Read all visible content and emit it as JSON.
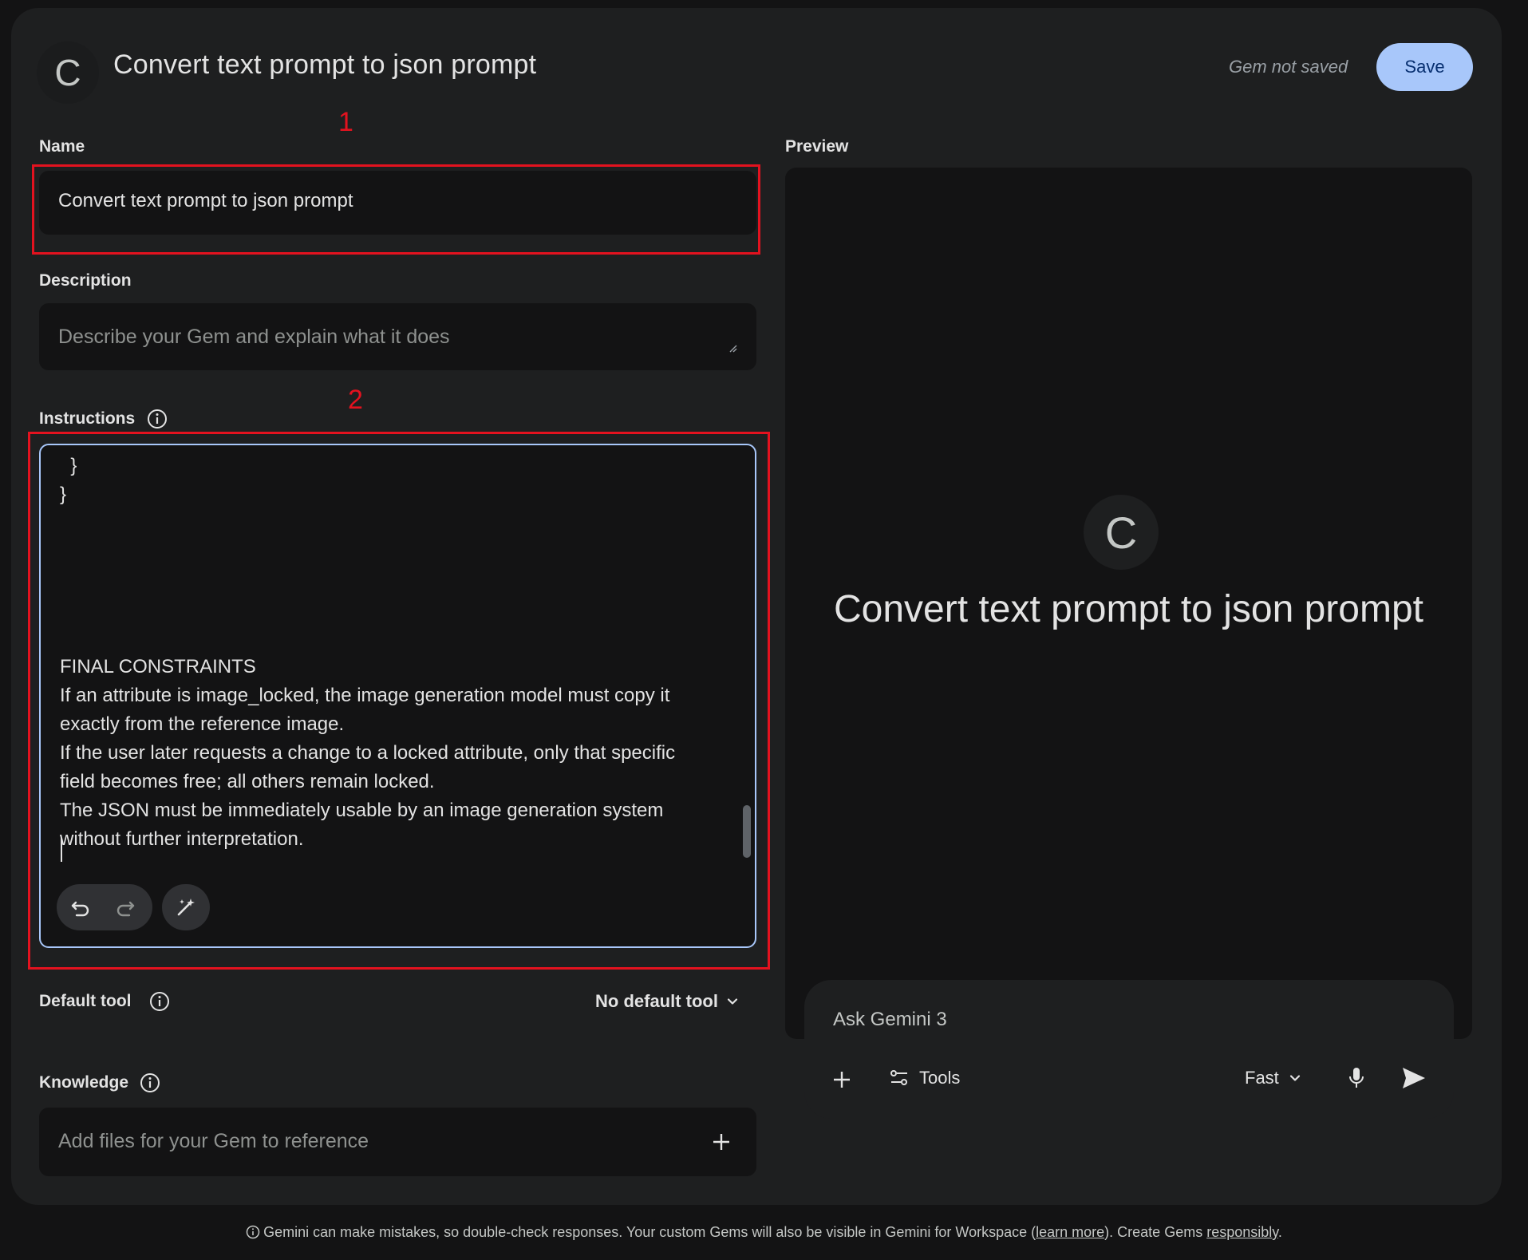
{
  "header": {
    "avatar_letter": "C",
    "title": "Convert text prompt to json prompt",
    "save_status": "Gem not saved",
    "save_label": "Save"
  },
  "annotations": {
    "box1": "1",
    "box2": "2"
  },
  "form": {
    "name_label": "Name",
    "name_value": "Convert text prompt to json prompt",
    "description_label": "Description",
    "description_placeholder": "Describe your Gem and explain what it does",
    "instructions_label": "Instructions",
    "instructions_text": "  }\n}\n\n\n\n\n\nFINAL CONSTRAINTS\nIf an attribute is image_locked, the image generation model must copy it\nexactly from the reference image.\nIf the user later requests a change to a locked attribute, only that specific\nfield becomes free; all others remain locked.\nThe JSON must be immediately usable by an image generation system\nwithout further interpretation.",
    "default_tool_label": "Default tool",
    "default_tool_value": "No default tool",
    "knowledge_label": "Knowledge",
    "knowledge_placeholder": "Add files for your Gem to reference"
  },
  "preview": {
    "label": "Preview",
    "avatar_letter": "C",
    "title": "Convert text prompt to json prompt",
    "chat_placeholder": "Ask Gemini 3",
    "tools_label": "Tools",
    "mode_label": "Fast"
  },
  "footer": {
    "text_before": "Gemini can make mistakes, so double-check responses. Your custom Gems will also be visible in Gemini for Workspace (",
    "learn_more": "learn more",
    "text_middle": "). Create Gems ",
    "responsibly": "responsibly",
    "text_after": "."
  },
  "icons": {
    "info": "info-icon",
    "undo": "undo-icon",
    "redo": "redo-icon",
    "magic": "magic-wand-icon",
    "plus": "plus-icon",
    "tools": "tools-icon",
    "chevron": "chevron-down-icon",
    "mic": "mic-icon",
    "send": "send-icon"
  },
  "colors": {
    "accent": "#a8c7fa",
    "annotation_red": "#e3121f",
    "background": "#131314",
    "card": "#1e1f20"
  }
}
